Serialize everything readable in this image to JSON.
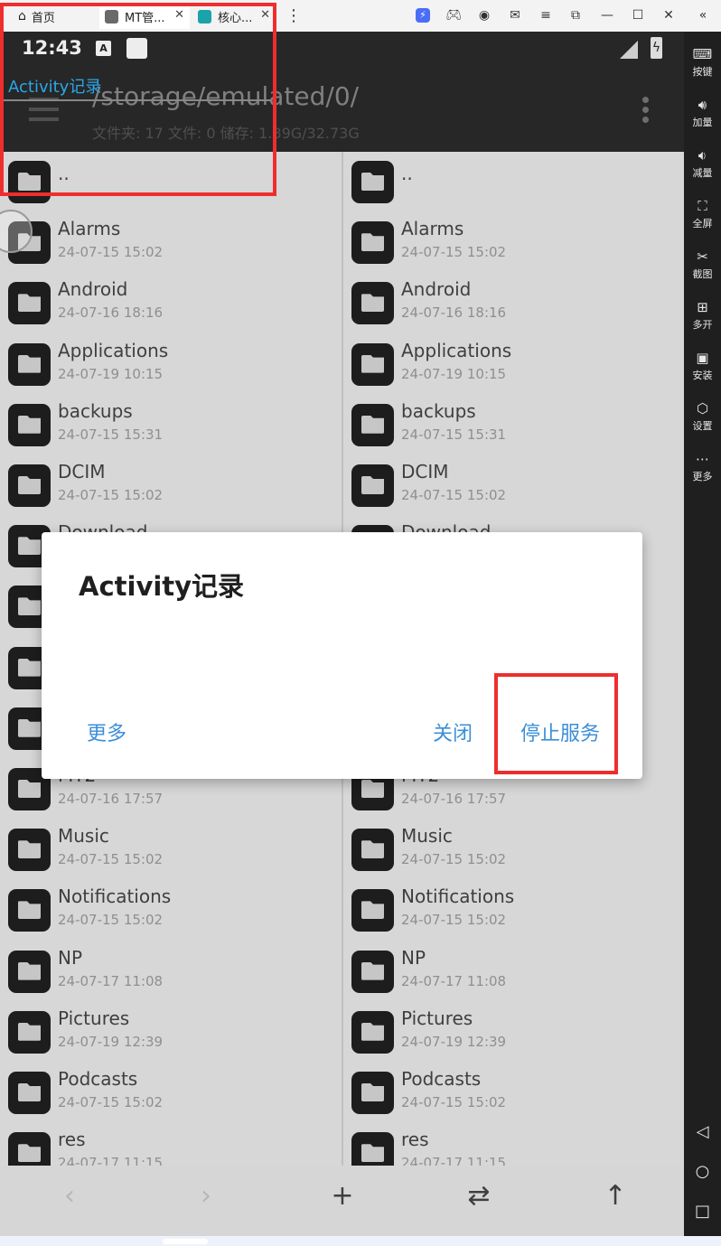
{
  "emulator": {
    "tabs": [
      {
        "label": "首页"
      },
      {
        "label": "MT管..."
      },
      {
        "label": "核心..."
      }
    ],
    "sidebar": [
      {
        "icon": "keyboard-icon",
        "label": "按键"
      },
      {
        "icon": "volume-up-icon",
        "label": "加量"
      },
      {
        "icon": "volume-down-icon",
        "label": "减量"
      },
      {
        "icon": "fullscreen-icon",
        "label": "全屏"
      },
      {
        "icon": "scissors-icon",
        "label": "截图"
      },
      {
        "icon": "multi-open-icon",
        "label": "多开"
      },
      {
        "icon": "apk-install-icon",
        "label": "安装"
      },
      {
        "icon": "settings-icon",
        "label": "设置"
      },
      {
        "icon": "more-icon",
        "label": "更多"
      }
    ]
  },
  "status": {
    "time": "12:43"
  },
  "appbar": {
    "path": "/storage/emulated/0/",
    "info": "文件夹: 17  文件: 0  储存: 1.89G/32.73G"
  },
  "overlay": {
    "title": "Activity记录"
  },
  "files": [
    {
      "name": "..",
      "date": ""
    },
    {
      "name": "Alarms",
      "date": "24-07-15 15:02"
    },
    {
      "name": "Android",
      "date": "24-07-16 18:16"
    },
    {
      "name": "Applications",
      "date": "24-07-19 10:15"
    },
    {
      "name": "backups",
      "date": "24-07-15 15:31"
    },
    {
      "name": "DCIM",
      "date": "24-07-15 15:02"
    },
    {
      "name": "Download",
      "date": ""
    },
    {
      "name": "",
      "date": ""
    },
    {
      "name": "",
      "date": ""
    },
    {
      "name": "",
      "date": ""
    },
    {
      "name": "MT2",
      "date": "24-07-16 17:57"
    },
    {
      "name": "Music",
      "date": "24-07-15 15:02"
    },
    {
      "name": "Notifications",
      "date": "24-07-15 15:02"
    },
    {
      "name": "NP",
      "date": "24-07-17 11:08"
    },
    {
      "name": "Pictures",
      "date": "24-07-19 12:39"
    },
    {
      "name": "Podcasts",
      "date": "24-07-15 15:02"
    },
    {
      "name": "res",
      "date": "24-07-17 11:15"
    }
  ],
  "dialog": {
    "title": "Activity记录",
    "more": "更多",
    "close": "关闭",
    "stop": "停止服务"
  },
  "colors": {
    "accent": "#3b8fd8",
    "highlight": "#ee2e2e",
    "overlay_text": "#2aa7e8"
  }
}
